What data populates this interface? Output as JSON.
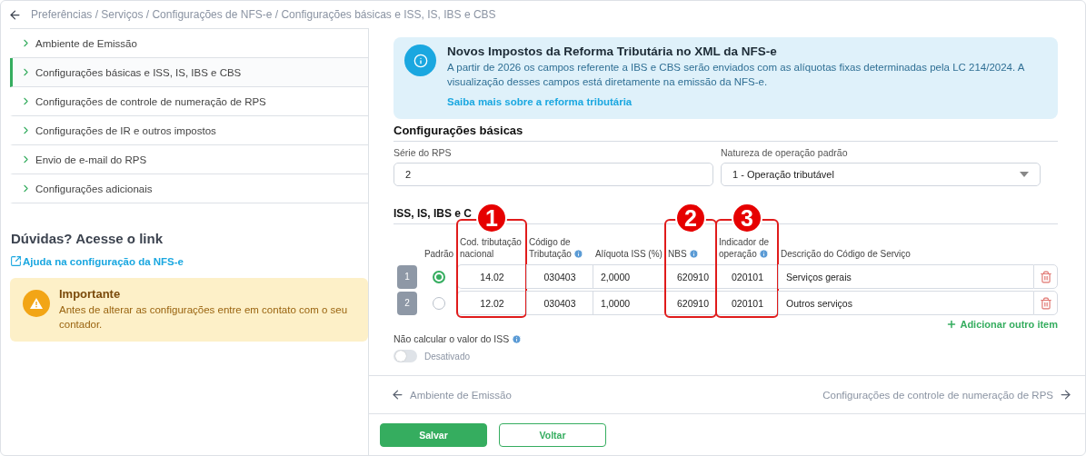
{
  "breadcrumb": "Preferências / Serviços / Configurações de NFS-e / Configurações básicas e ISS, IS, IBS e CBS",
  "sidebar": {
    "items": [
      {
        "label": "Ambiente de Emissão",
        "selected": false
      },
      {
        "label": "Configurações básicas e ISS, IS, IBS e CBS",
        "selected": true
      },
      {
        "label": "Configurações de controle de numeração de RPS",
        "selected": false
      },
      {
        "label": "Configurações de IR e outros impostos",
        "selected": false
      },
      {
        "label": "Envio de e-mail do RPS",
        "selected": false
      },
      {
        "label": "Configurações adicionais",
        "selected": false
      }
    ],
    "help_title": "Dúvidas? Acesse o link",
    "help_link": "Ajuda na configuração da NFS-e",
    "notice": {
      "title": "Importante",
      "text": "Antes de alterar as configurações entre em contato com o seu contador."
    }
  },
  "banner": {
    "title": "Novos Impostos da Reforma Tributária no XML da NFS-e",
    "text": "A partir de 2026 os campos referente a IBS e CBS serão enviados com as alíquotas fixas determinadas pela LC 214/2024. A visualização desses campos está diretamente na emissão da NFS-e.",
    "link": "Saiba mais sobre a reforma tributária"
  },
  "basic": {
    "title": "Configurações básicas",
    "fields": [
      {
        "label": "Série do RPS",
        "value": "2",
        "kind": "text"
      },
      {
        "label": "Natureza de operação padrão",
        "value": "1 - Operação tributável",
        "kind": "select"
      }
    ]
  },
  "iss": {
    "title": "ISS, IS, IBS e C",
    "default_label": "Padrão",
    "columns": [
      {
        "label": "Cod. tributação nacional",
        "annotation": "1"
      },
      {
        "label": "Código de Tributação",
        "info": true
      },
      {
        "label": "Alíquota ISS (%)"
      },
      {
        "label": "NBS",
        "info": true,
        "annotation": "2"
      },
      {
        "label": "Indicador de operação",
        "info": true,
        "annotation": "3"
      },
      {
        "label": "Descrição do Código de Serviço"
      }
    ],
    "rows": [
      {
        "number": "1",
        "selected": true,
        "values": [
          "14.02",
          "030403",
          "2,0000",
          "620910",
          "020101",
          "Serviços gerais"
        ]
      },
      {
        "number": "2",
        "selected": false,
        "values": [
          "12.02",
          "030403",
          "1,0000",
          "620910",
          "020101",
          "Outros serviços"
        ]
      }
    ],
    "add_label": "Adicionar outro item"
  },
  "toggle": {
    "label": "Não calcular o valor do ISS",
    "on": false,
    "state_text": "Desativado"
  },
  "pager": {
    "prev": "Ambiente de Emissão",
    "next": "Configurações de controle de numeração de RPS"
  },
  "buttons": [
    {
      "label": "Salvar",
      "kind": "primary"
    },
    {
      "label": "Voltar",
      "kind": "secondary"
    }
  ]
}
